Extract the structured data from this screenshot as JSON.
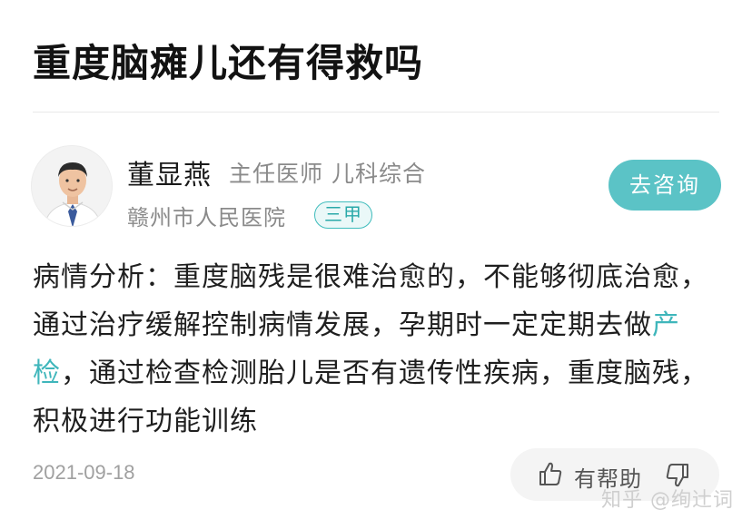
{
  "question": {
    "title": "重度脑瘫儿还有得救吗"
  },
  "doctor": {
    "name": "董显燕",
    "title": "主任医师 儿科综合",
    "hospital": "赣州市人民医院",
    "grade_badge": "三甲",
    "consult_button": "去咨询",
    "avatar_icon": "doctor-avatar"
  },
  "answer": {
    "text_before_link": "病情分析：重度脑残是很难治愈的，不能够彻底治愈，通过治疗缓解控制病情发展，孕期时一定定期去做",
    "link_text": "产检",
    "text_after_link": "，通过检查检测胎儿是否有遗传性疾病，重度脑残，积极进行功能训练",
    "date": "2021-09-18",
    "helpful_label": "有帮助"
  },
  "watermark": "知乎 @绚辻词",
  "colors": {
    "accent": "#5bc3c6",
    "link": "#3fb6bb",
    "badge_border": "#3fbcbc",
    "muted_text": "#8a8a8a"
  },
  "icons": {
    "helpful": "thumb-up-icon",
    "unhelpful": "thumb-down-icon"
  }
}
